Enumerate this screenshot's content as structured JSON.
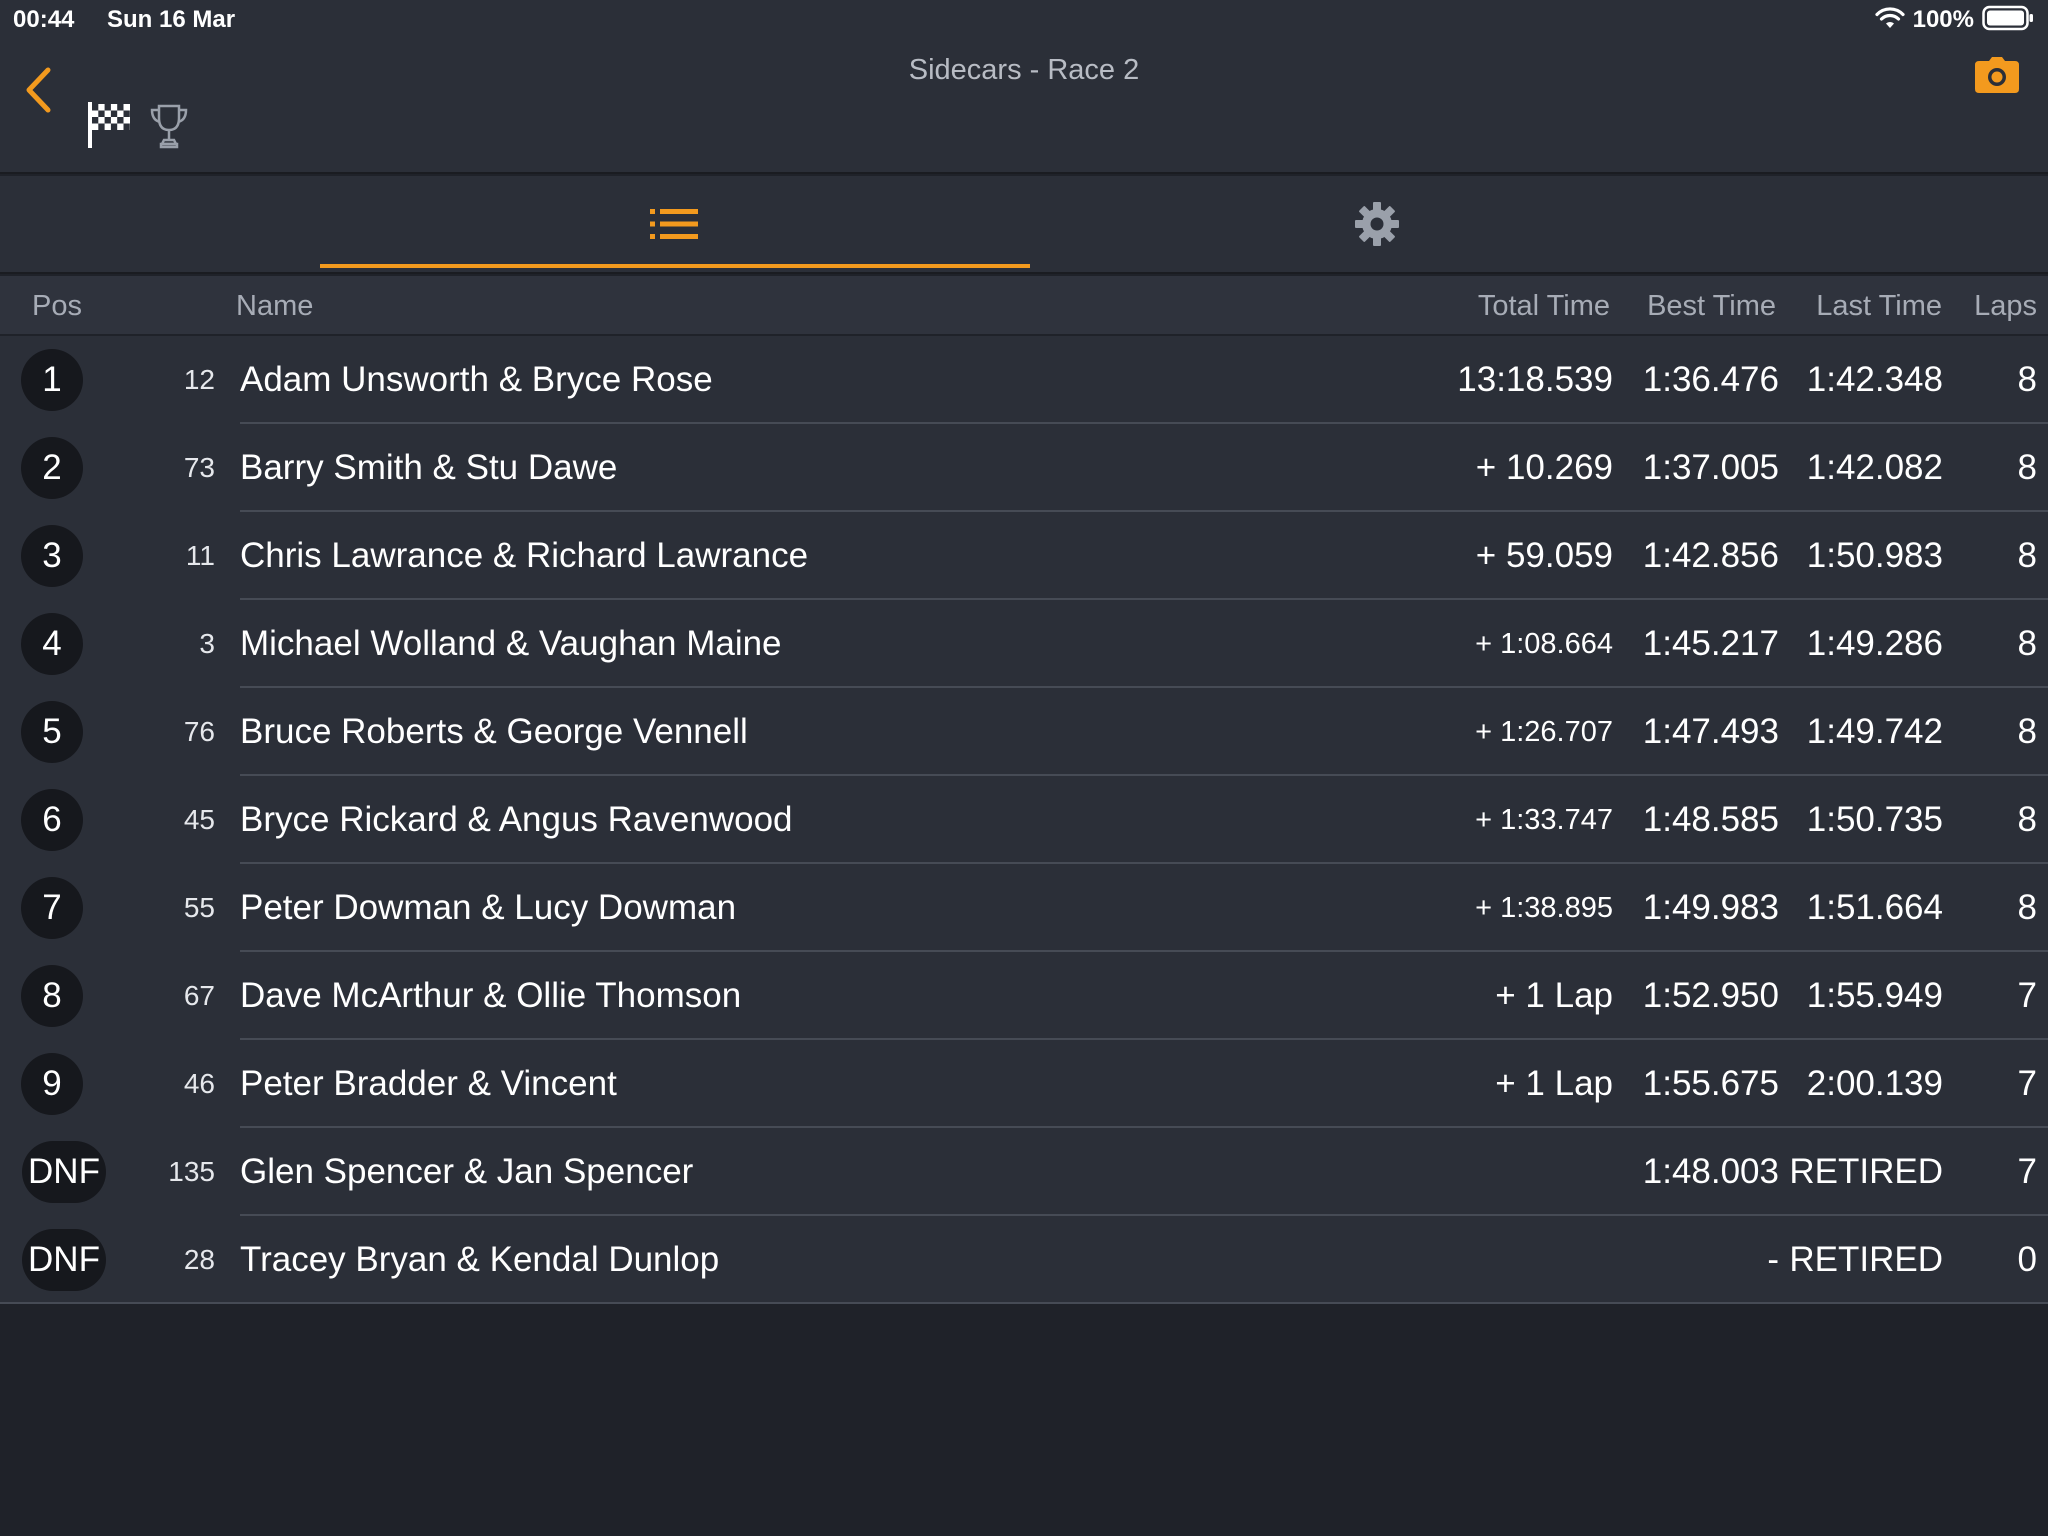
{
  "status_bar": {
    "time": "00:44",
    "date": "Sun 16 Mar",
    "battery": "100%"
  },
  "nav": {
    "title": "Sidecars - Race 2"
  },
  "colors": {
    "accent": "#f39a1e",
    "background": "#1f2229",
    "row_bg": "#2b2f38"
  },
  "table": {
    "headers": {
      "pos": "Pos",
      "name": "Name",
      "total": "Total Time",
      "best": "Best Time",
      "last": "Last Time",
      "laps": "Laps"
    },
    "rows": [
      {
        "pos": "1",
        "num": "12",
        "name": "Adam Unsworth & Bryce Rose",
        "total": "13:18.539",
        "best": "1:36.476",
        "last": "1:42.348",
        "laps": "8"
      },
      {
        "pos": "2",
        "num": "73",
        "name": "Barry Smith & Stu Dawe",
        "total": "+ 10.269",
        "best": "1:37.005",
        "last": "1:42.082",
        "laps": "8"
      },
      {
        "pos": "3",
        "num": "11",
        "name": "Chris Lawrance & Richard Lawrance",
        "total": "+ 59.059",
        "best": "1:42.856",
        "last": "1:50.983",
        "laps": "8"
      },
      {
        "pos": "4",
        "num": "3",
        "name": "Michael Wolland & Vaughan Maine",
        "total": "+ 1:08.664",
        "best": "1:45.217",
        "last": "1:49.286",
        "laps": "8"
      },
      {
        "pos": "5",
        "num": "76",
        "name": "Bruce Roberts & George Vennell",
        "total": "+ 1:26.707",
        "best": "1:47.493",
        "last": "1:49.742",
        "laps": "8"
      },
      {
        "pos": "6",
        "num": "45",
        "name": "Bryce Rickard & Angus Ravenwood",
        "total": "+ 1:33.747",
        "best": "1:48.585",
        "last": "1:50.735",
        "laps": "8"
      },
      {
        "pos": "7",
        "num": "55",
        "name": "Peter Dowman & Lucy Dowman",
        "total": "+ 1:38.895",
        "best": "1:49.983",
        "last": "1:51.664",
        "laps": "8"
      },
      {
        "pos": "8",
        "num": "67",
        "name": "Dave McArthur & Ollie Thomson",
        "total": "+ 1 Lap",
        "best": "1:52.950",
        "last": "1:55.949",
        "laps": "7"
      },
      {
        "pos": "9",
        "num": "46",
        "name": "Peter Bradder & Vincent",
        "total": "+ 1 Lap",
        "best": "1:55.675",
        "last": "2:00.139",
        "laps": "7"
      },
      {
        "pos": "DNF",
        "num": "135",
        "name": "Glen Spencer & Jan Spencer",
        "total": "",
        "best": "1:48.003",
        "last": "RETIRED",
        "laps": "7"
      },
      {
        "pos": "DNF",
        "num": "28",
        "name": "Tracey Bryan & Kendal Dunlop",
        "total": "",
        "best": "-",
        "last": "RETIRED",
        "laps": "0"
      }
    ]
  }
}
